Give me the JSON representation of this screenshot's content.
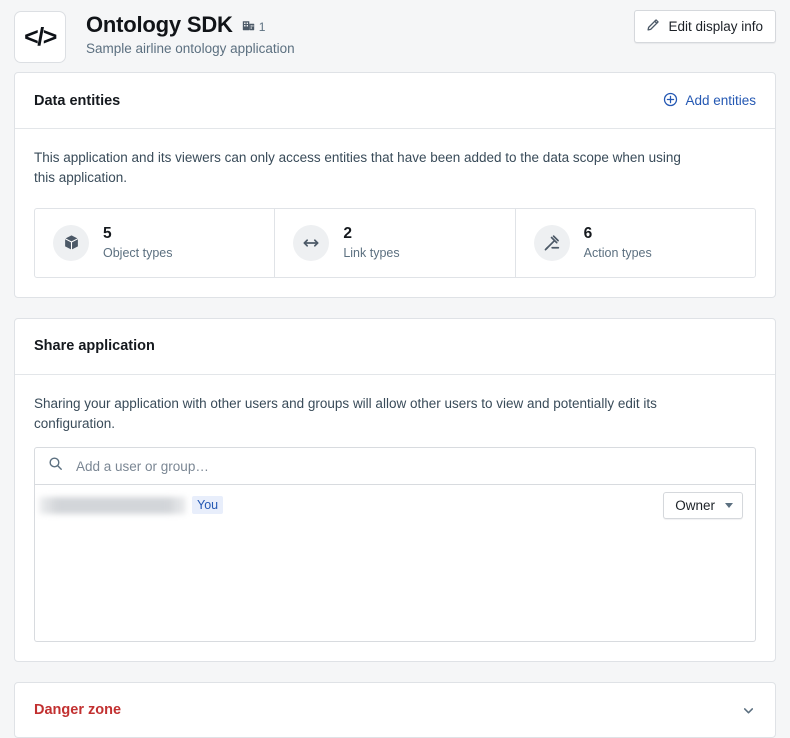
{
  "header": {
    "logo_glyph": "</>",
    "title": "Ontology SDK",
    "org_count": "1",
    "subtitle": "Sample airline ontology application",
    "edit_button_label": "Edit display info"
  },
  "data_entities": {
    "title": "Data entities",
    "add_link_label": "Add entities",
    "description": "This application and its viewers can only access entities that have been added to the data scope when using this application.",
    "stats": [
      {
        "icon": "cube-icon",
        "value": "5",
        "label": "Object types"
      },
      {
        "icon": "link-arrows-icon",
        "value": "2",
        "label": "Link types"
      },
      {
        "icon": "gavel-icon",
        "value": "6",
        "label": "Action types"
      }
    ]
  },
  "share": {
    "title": "Share application",
    "description": "Sharing your application with other users and groups will allow other users to view and potentially edit its configuration.",
    "search_placeholder": "Add a user or group…",
    "search_value": "",
    "members": [
      {
        "name": "",
        "name_redacted": true,
        "badge": "You",
        "role": "Owner"
      }
    ]
  },
  "danger_zone": {
    "title": "Danger zone",
    "expanded": false
  },
  "colors": {
    "page_background": "#f5f6f7",
    "card_background": "#ffffff",
    "accent_blue": "#2458b3",
    "danger_red": "#c23030",
    "text_primary": "#15191e",
    "text_muted": "#5c7080"
  }
}
